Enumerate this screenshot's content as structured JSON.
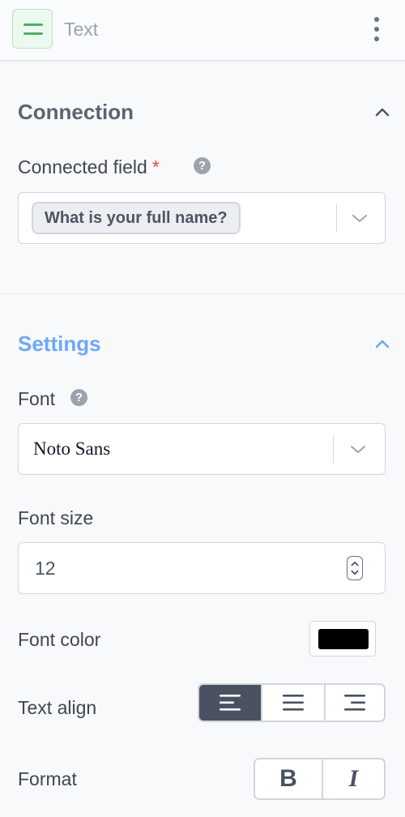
{
  "header": {
    "title": "Text",
    "icon": "text-block-icon",
    "menu_icon": "more-vertical-icon"
  },
  "connection": {
    "title": "Connection",
    "connected_field": {
      "label": "Connected field",
      "required_mark": "*",
      "help_glyph": "?",
      "selected_tag": "What is your full name?"
    }
  },
  "settings": {
    "title": "Settings",
    "font": {
      "label": "Font",
      "help_glyph": "?",
      "value": "Noto Sans"
    },
    "font_size": {
      "label": "Font size",
      "value": "12"
    },
    "font_color": {
      "label": "Font color",
      "value": "#000000"
    },
    "text_align": {
      "label": "Text align",
      "options": [
        "align-left-icon",
        "align-center-icon",
        "align-right-icon"
      ],
      "selected": "align-left-icon"
    },
    "format": {
      "label": "Format",
      "bold_label": "B",
      "italic_label": "I"
    }
  },
  "colors": {
    "connection_title": "#5c6370",
    "settings_title": "#6ea8f7",
    "accent_green": "#4caf68",
    "active_segment": "#4a5262"
  }
}
